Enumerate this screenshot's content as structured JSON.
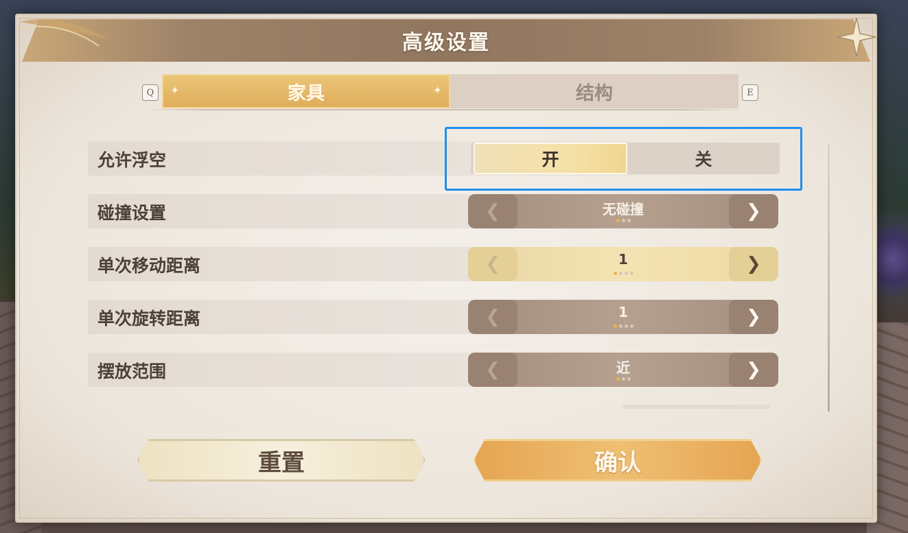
{
  "window": {
    "title": "高级设置"
  },
  "tabs": {
    "prev_key": "Q",
    "next_key": "E",
    "items": [
      {
        "label": "家具",
        "active": true
      },
      {
        "label": "结构",
        "active": false
      }
    ]
  },
  "settings": {
    "float": {
      "label": "允许浮空",
      "on_label": "开",
      "off_label": "关",
      "selected": "开"
    },
    "collision": {
      "label": "碰撞设置",
      "value": "无碰撞",
      "option_count": 3,
      "selected_index": 0
    },
    "move_distance": {
      "label": "单次移动距离",
      "value": "1",
      "option_count": 4,
      "selected_index": 0
    },
    "rotate_distance": {
      "label": "单次旋转距离",
      "value": "1",
      "option_count": 4,
      "selected_index": 0
    },
    "placement_range": {
      "label": "摆放范围",
      "value": "近",
      "option_count": 3,
      "selected_index": 0
    }
  },
  "arrows": {
    "left": "❮",
    "right": "❯"
  },
  "footer": {
    "reset_label": "重置",
    "confirm_label": "确认"
  },
  "colors": {
    "highlight": "#1e8ef0",
    "accent_gold": "#e0ad5c",
    "dot_active": "#e9b548"
  }
}
